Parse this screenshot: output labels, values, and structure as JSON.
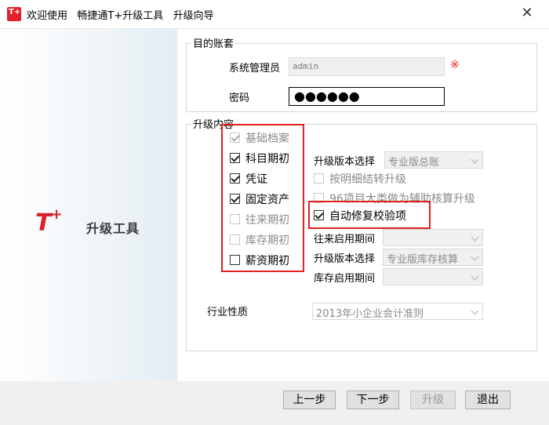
{
  "titlebar": {
    "logo_text": "T+",
    "title": "欢迎使用   畅捷通T+升级工具   升级向导",
    "close_glyph": "✕"
  },
  "banner": {
    "logo": "T+",
    "product_text": "升级工具"
  },
  "target_account": {
    "group_title": "目的账套",
    "admin_label": "系统管理员",
    "admin_value": "admin",
    "required_mark": "※",
    "password_label": "密码",
    "password_mask": "●●●●●●"
  },
  "upgrade_content": {
    "group_title": "升级内容",
    "modules": [
      {
        "label": "基础档案",
        "checked": true,
        "disabled": true
      },
      {
        "label": "科目期初",
        "checked": true,
        "disabled": false
      },
      {
        "label": "凭证",
        "checked": true,
        "disabled": false
      },
      {
        "label": "固定资产",
        "checked": true,
        "disabled": false
      },
      {
        "label": "往来期初",
        "checked": false,
        "disabled": true
      },
      {
        "label": "库存期初",
        "checked": false,
        "disabled": true
      },
      {
        "label": "薪资期初",
        "checked": false,
        "disabled": false
      }
    ],
    "version_select_label": "升级版本选择",
    "version_select_value": "专业版总账",
    "detail_carry_label": "按明细结转升级",
    "item_category_label": "96项目大类做为辅助核算升级",
    "auto_repair_label": "自动修复校验项",
    "ar_period_label": "往来启用期间",
    "ar_period_value": "",
    "version_select2_label": "升级版本选择",
    "version_select2_value": "专业版库存核算",
    "inventory_period_label": "库存启用期间",
    "inventory_period_value": ""
  },
  "industry": {
    "label": "行业性质",
    "value": "2013年小企业会计准则"
  },
  "footer": {
    "prev": "上一步",
    "next": "下一步",
    "upgrade": "升级",
    "exit": "退出"
  },
  "colors": {
    "accent_red": "#e02020",
    "brand_red": "#d7212a"
  }
}
